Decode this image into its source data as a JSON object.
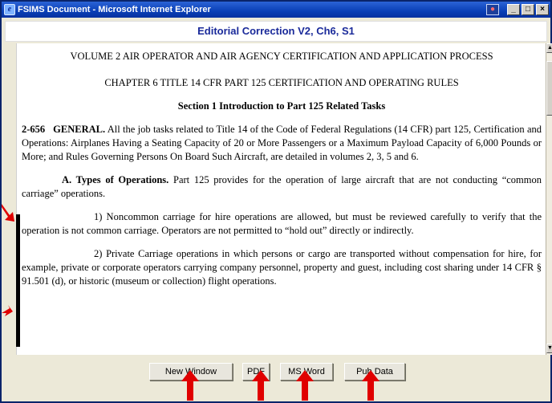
{
  "window": {
    "title": "FSIMS Document - Microsoft Internet Explorer",
    "controls": {
      "minimize": "_",
      "maximize": "□",
      "close": "×"
    }
  },
  "header": {
    "title": "Editorial Correction V2, Ch6, S1"
  },
  "document": {
    "volume": "VOLUME 2  AIR OPERATOR AND AIR AGENCY CERTIFICATION AND APPLICATION PROCESS",
    "chapter": "CHAPTER 6  TITLE 14 CFR PART 125 CERTIFICATION AND OPERATING RULES",
    "section": "Section 1  Introduction to Part 125 Related Tasks",
    "general_num": "2-656",
    "general_head": "GENERAL.",
    "general_text": " All the job tasks related to Title 14 of the Code of Federal Regulations (14 CFR) part 125, Certification and Operations: Airplanes Having a Seating Capacity of 20 or More Passengers or a Maximum Payload Capacity of 6,000 Pounds or More; and Rules Governing Persons On Board Such Aircraft, are detailed in volumes 2, 3, 5 and 6.",
    "a_head": "A.  Types of Operations.",
    "a_text": " Part 125 provides for the operation of large aircraft that are not conducting “common carriage” operations.",
    "item1": "1)  Noncommon carriage for hire operations are allowed, but must be reviewed carefully  to verify that the operation is not common carriage. Operators are not permitted to “hold out” directly or indirectly.",
    "item2": "2)  Private Carriage operations in which persons or cargo are transported without compensation for hire, for example, private or corporate operators carrying company personnel, property and guest, including cost sharing under 14 CFR § 91.501 (d), or historic (museum or collection) flight operations."
  },
  "footer": {
    "buttons": [
      "New Window",
      "PDF",
      "MS Word",
      "Pub Data"
    ]
  },
  "colors": {
    "annotation": "#e00000",
    "header_text": "#1a2a9a",
    "titlebar": "#0a3fb6"
  },
  "icons": [
    "ie-icon",
    "scroll-up-icon",
    "scroll-down-icon",
    "arrow-up-icon"
  ]
}
